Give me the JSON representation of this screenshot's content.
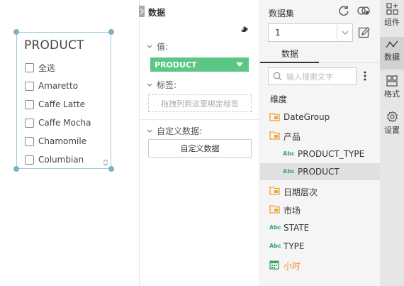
{
  "canvas": {
    "widget": {
      "title": "PRODUCT",
      "items": [
        "全选",
        "Amaretto",
        "Caffe Latte",
        "Caffe Mocha",
        "Chamomile",
        "Columbian"
      ]
    }
  },
  "data_panel": {
    "title": "数据",
    "value_label": "值:",
    "value_field": "PRODUCT",
    "tag_label": "标签:",
    "tag_placeholder": "拖拽列到这里绑定标签",
    "custom_label": "自定义数据:",
    "custom_button": "自定义数据"
  },
  "dataset": {
    "title": "数据集",
    "selected": "1",
    "tab": "数据",
    "search_placeholder": "输入搜索文字",
    "dimension_label": "维度",
    "tree": [
      {
        "label": "DateGroup",
        "icon": "folder-icon"
      },
      {
        "label": "产品",
        "icon": "folder-icon"
      },
      {
        "label": "PRODUCT_TYPE",
        "icon": "abc-text-icon"
      },
      {
        "label": "PRODUCT",
        "icon": "abc-text-icon"
      },
      {
        "label": "日期层次",
        "icon": "folder-icon"
      },
      {
        "label": "市场",
        "icon": "folder-icon"
      },
      {
        "label": "STATE",
        "icon": "abc-text-icon"
      },
      {
        "label": "TYPE",
        "icon": "abc-text-icon"
      },
      {
        "label": "小时",
        "icon": "calendar-icon"
      }
    ],
    "abc_text": "Abc"
  },
  "rail": {
    "items": [
      "组件",
      "数据",
      "格式",
      "设置"
    ]
  },
  "colors": {
    "accent_green": "#5cc784",
    "folder_orange": "#f0a030",
    "hour_orange": "#f08c22",
    "rail_bg": "#e6e6e6",
    "selected_row": "#e0e0e0"
  }
}
